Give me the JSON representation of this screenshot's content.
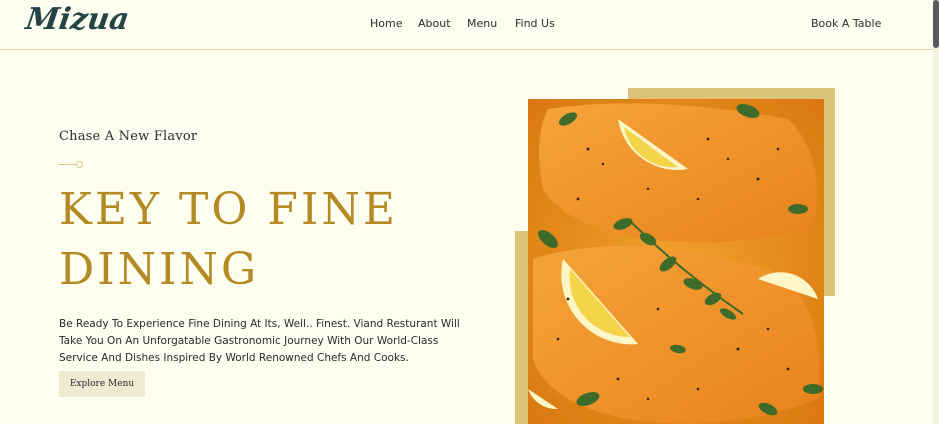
{
  "brand": {
    "logo_text": "Mizua"
  },
  "nav": {
    "items": [
      {
        "label": "Home"
      },
      {
        "label": "About"
      },
      {
        "label": "Menu"
      },
      {
        "label": "Find Us"
      }
    ],
    "cta_label": "Book A Table"
  },
  "hero": {
    "tagline": "Chase A New Flavor",
    "headline_line1": "KEY TO FINE",
    "headline_line2": "DINING",
    "description": "Be Ready To Experience Fine Dining At Its, Well.. Finest. Viand Resturant Will Take You On An Unforgatable Gastronomic Journey With Our World-Class Service And Dishes Inspired By World Renowned Chefs And Cooks.",
    "button_label": "Explore Menu",
    "image_subject": "salmon-fillets-with-lemon-and-herbs"
  },
  "colors": {
    "background": "#fdfdf0",
    "accent_gold": "#b38a23",
    "frame_gold": "#dcc37a",
    "logo": "#244446",
    "button_bg": "#f1ead2"
  }
}
